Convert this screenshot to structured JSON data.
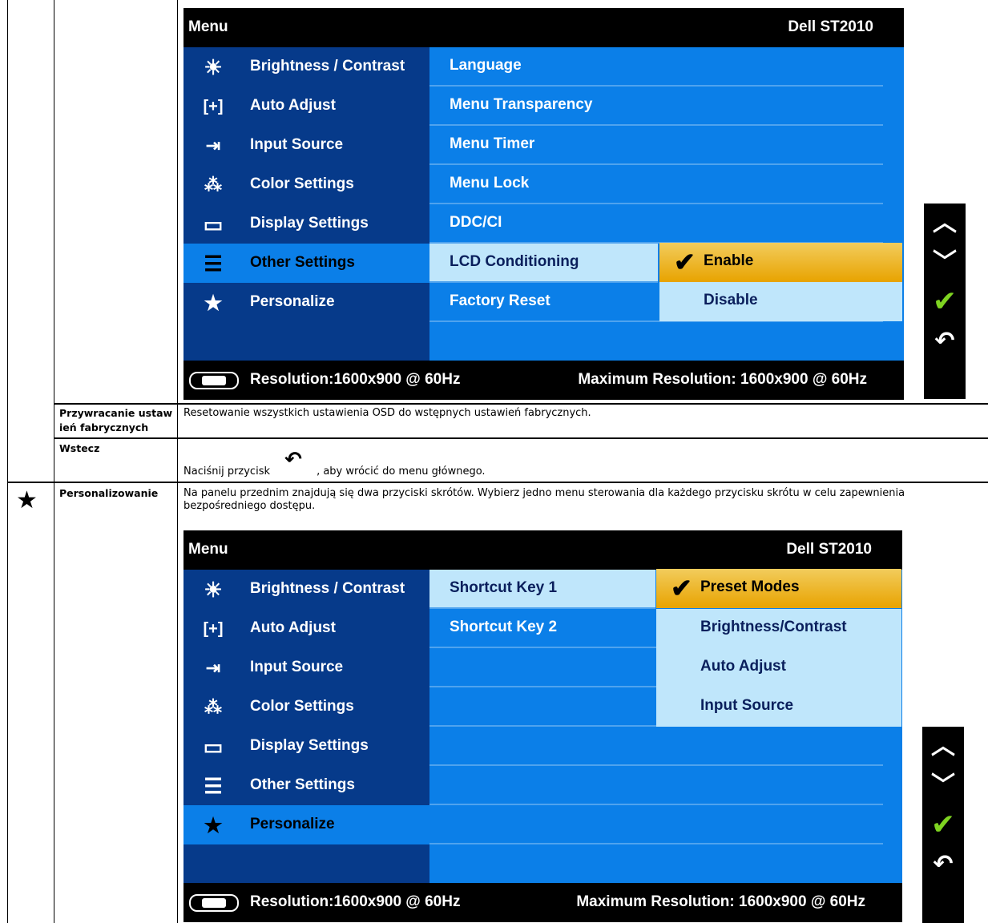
{
  "rows": {
    "factory_reset": {
      "label": "Przywracanie ustaw ień fabrycznych",
      "desc": "Resetowanie wszystkich ustawienia OSD do wstępnych ustawień fabrycznych."
    },
    "back": {
      "label": "Wstecz",
      "desc_before": "Naciśnij przycisk",
      "desc_after": ", aby wrócić do menu głównego."
    },
    "personalize": {
      "label": "Personalizowanie",
      "desc": "Na panelu przednim znajdują się dwa przyciski skrótów. Wybierz jedno menu sterowania dla każdego przycisku skrótu w celu zapewnienia bezpośredniego dostępu."
    }
  },
  "osd_common": {
    "title": "Menu",
    "model": "Dell ST2010",
    "menu_items": [
      "Brightness / Contrast",
      "Auto Adjust",
      "Input Source",
      "Color Settings",
      "Display Settings",
      "Other Settings",
      "Personalize"
    ],
    "resolution": "Resolution:1600x900 @ 60Hz",
    "max_resolution": "Maximum Resolution: 1600x900 @ 60Hz"
  },
  "osd1": {
    "sub_items": [
      "Language",
      "Menu Transparency",
      "Menu Timer",
      "Menu Lock",
      "DDC/CI",
      "LCD Conditioning",
      "Factory Reset"
    ],
    "options": [
      "Enable",
      "Disable"
    ]
  },
  "osd2": {
    "sub_items": [
      "Shortcut Key 1",
      "Shortcut Key 2"
    ],
    "options": [
      "Preset Modes",
      "Brightness/Contrast",
      "Auto Adjust",
      "Input Source"
    ]
  },
  "icons": [
    "sun-icon",
    "auto-adjust-icon",
    "input-source-icon",
    "color-dots-icon",
    "display-icon",
    "sliders-icon",
    "star-icon",
    "up-arrow-icon",
    "down-arrow-icon",
    "check-icon",
    "back-icon"
  ],
  "colors": {
    "osd_dark": "#063a8a",
    "osd_blue": "#0b7fe8",
    "osd_light": "#bfe6fb",
    "gold": "#e8a300"
  }
}
